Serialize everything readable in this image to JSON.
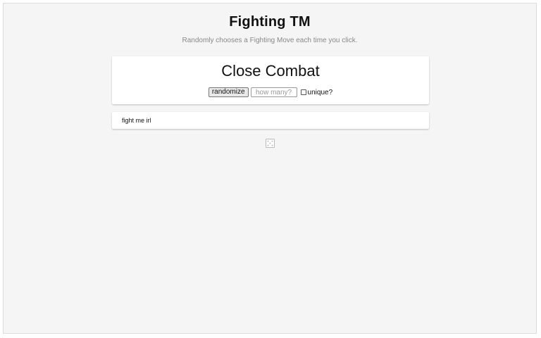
{
  "header": {
    "title": "Fighting TM",
    "subtitle": "Randomly chooses a Fighting Move each time you click."
  },
  "result": {
    "value": "Close Combat"
  },
  "controls": {
    "randomize_label": "randomize",
    "count_placeholder": "how many?",
    "count_value": "",
    "unique_label": "unique?",
    "unique_checked": false
  },
  "info": {
    "text": "fight me irl"
  },
  "icons": {
    "dice": "dice-icon"
  },
  "colors": {
    "background": "#f5f5f5",
    "card": "#ffffff",
    "subtitle": "#888888"
  }
}
